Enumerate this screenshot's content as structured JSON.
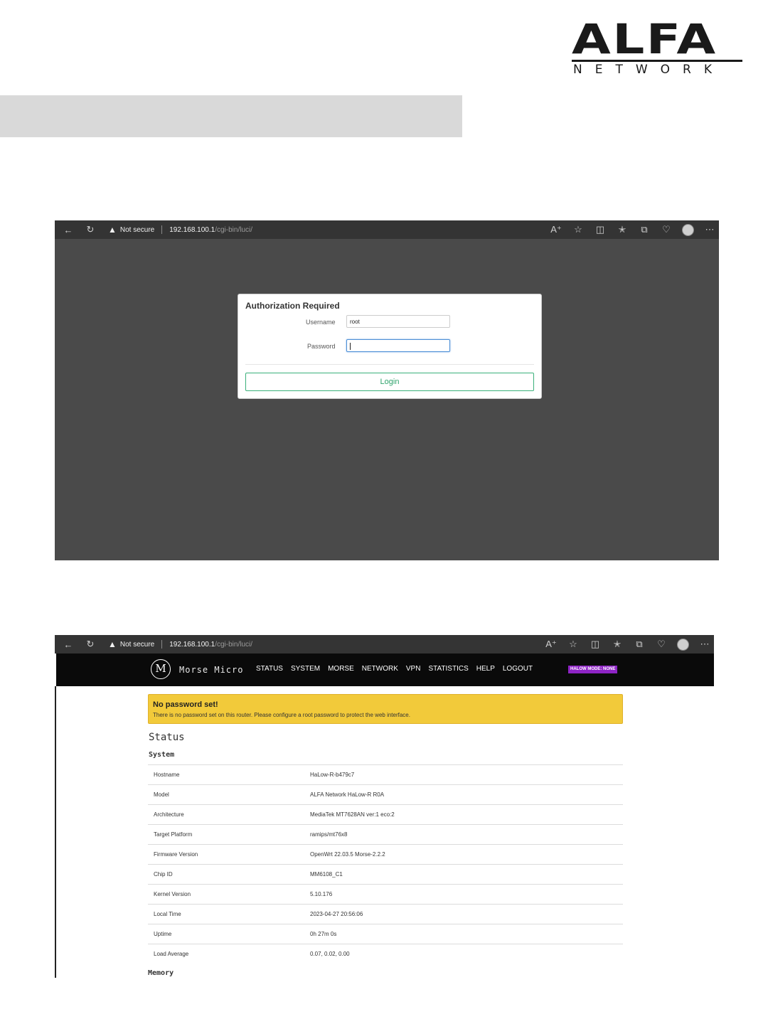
{
  "logo": {
    "word": "ALFA",
    "sub": "NETWORK"
  },
  "browser": {
    "not_secure": "Not secure",
    "url_host": "192.168.100.1",
    "url_path": "/cgi-bin/luci/"
  },
  "login": {
    "title": "Authorization Required",
    "username_label": "Username",
    "username_value": "root",
    "password_label": "Password",
    "password_value": "",
    "login_button": "Login"
  },
  "morse": {
    "brand": "Morse Micro",
    "logo_letter": "M",
    "menu": [
      "STATUS",
      "SYSTEM",
      "MORSE",
      "NETWORK",
      "VPN",
      "STATISTICS",
      "HELP",
      "LOGOUT"
    ],
    "halow_badge": "HALOW MODE: NONE",
    "alert": {
      "title": "No password set!",
      "body": "There is no password set on this router. Please configure a root password to protect the web interface."
    },
    "status_heading": "Status",
    "system_heading": "System",
    "system_rows": [
      {
        "k": "Hostname",
        "v": "HaLow-R-b479c7"
      },
      {
        "k": "Model",
        "v": "ALFA Network HaLow-R R0A"
      },
      {
        "k": "Architecture",
        "v": "MediaTek MT7628AN ver:1 eco:2"
      },
      {
        "k": "Target Platform",
        "v": "ramips/mt76x8"
      },
      {
        "k": "Firmware Version",
        "v": "OpenWrt 22.03.5 Morse-2.2.2"
      },
      {
        "k": "Chip ID",
        "v": "MM6108_C1"
      },
      {
        "k": "Kernel Version",
        "v": "5.10.176"
      },
      {
        "k": "Local Time",
        "v": "2023-04-27 20:56:06"
      },
      {
        "k": "Uptime",
        "v": "0h 27m 0s"
      },
      {
        "k": "Load Average",
        "v": "0.07, 0.02, 0.00"
      }
    ],
    "memory_heading": "Memory"
  },
  "icons": [
    "back-icon",
    "refresh-icon",
    "warning-icon",
    "read-aloud-icon",
    "favorite-star-icon",
    "split-screen-icon",
    "favorites-icon",
    "collections-icon",
    "browser-essentials-icon",
    "profile-avatar-icon",
    "more-icon"
  ]
}
